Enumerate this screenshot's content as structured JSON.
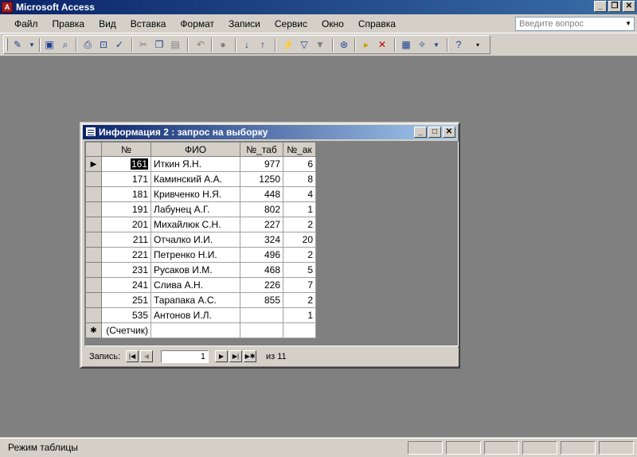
{
  "app": {
    "title": "Microsoft Access",
    "icon_letter": "A"
  },
  "window_controls": {
    "minimize": "_",
    "restore": "❐",
    "close": "✕"
  },
  "menu": [
    "Файл",
    "Правка",
    "Вид",
    "Вставка",
    "Формат",
    "Записи",
    "Сервис",
    "Окно",
    "Справка"
  ],
  "ask_box": {
    "placeholder": "Введите вопрос"
  },
  "toolbar": {
    "icons": [
      "view-design-icon",
      "save-icon",
      "file-search-icon",
      "print-icon",
      "print-preview-icon",
      "spelling-icon",
      "cut-icon",
      "copy-icon",
      "paste-icon",
      "undo-icon",
      "insert-object-icon",
      "sort-ascending-icon",
      "sort-descending-icon",
      "filter-by-selection-icon",
      "filter-by-form-icon",
      "apply-filter-icon",
      "find-icon",
      "new-record-icon",
      "delete-record-icon",
      "database-window-icon",
      "new-object-icon",
      "help-icon"
    ]
  },
  "query_window": {
    "title": "Информация 2 : запрос на выборку",
    "columns": [
      "№",
      "ФИО",
      "№_таб",
      "№_ак"
    ],
    "rows": [
      [
        "161",
        "Иткин Я.Н.",
        "977",
        "6"
      ],
      [
        "171",
        "Каминский А.А.",
        "1250",
        "8"
      ],
      [
        "181",
        "Кривченко Н.Я.",
        "448",
        "4"
      ],
      [
        "191",
        "Лабунец А.Г.",
        "802",
        "1"
      ],
      [
        "201",
        "Михайлюк С.Н.",
        "227",
        "2"
      ],
      [
        "211",
        "Отчалко И.И.",
        "324",
        "20"
      ],
      [
        "221",
        "Петренко Н.И.",
        "496",
        "2"
      ],
      [
        "231",
        "Русаков И.М.",
        "468",
        "5"
      ],
      [
        "241",
        "Слива А.Н.",
        "226",
        "7"
      ],
      [
        "251",
        "Тарапака А.С.",
        "855",
        "2"
      ],
      [
        "535",
        "Антонов И.Л.",
        "",
        "1"
      ]
    ],
    "new_row": {
      "marker": "✱",
      "placeholder": "(Счетчик)"
    },
    "current_marker": "▶",
    "nav": {
      "label": "Запись:",
      "current": "1",
      "total_label": "из 11"
    }
  },
  "status": {
    "mode": "Режим таблицы"
  }
}
